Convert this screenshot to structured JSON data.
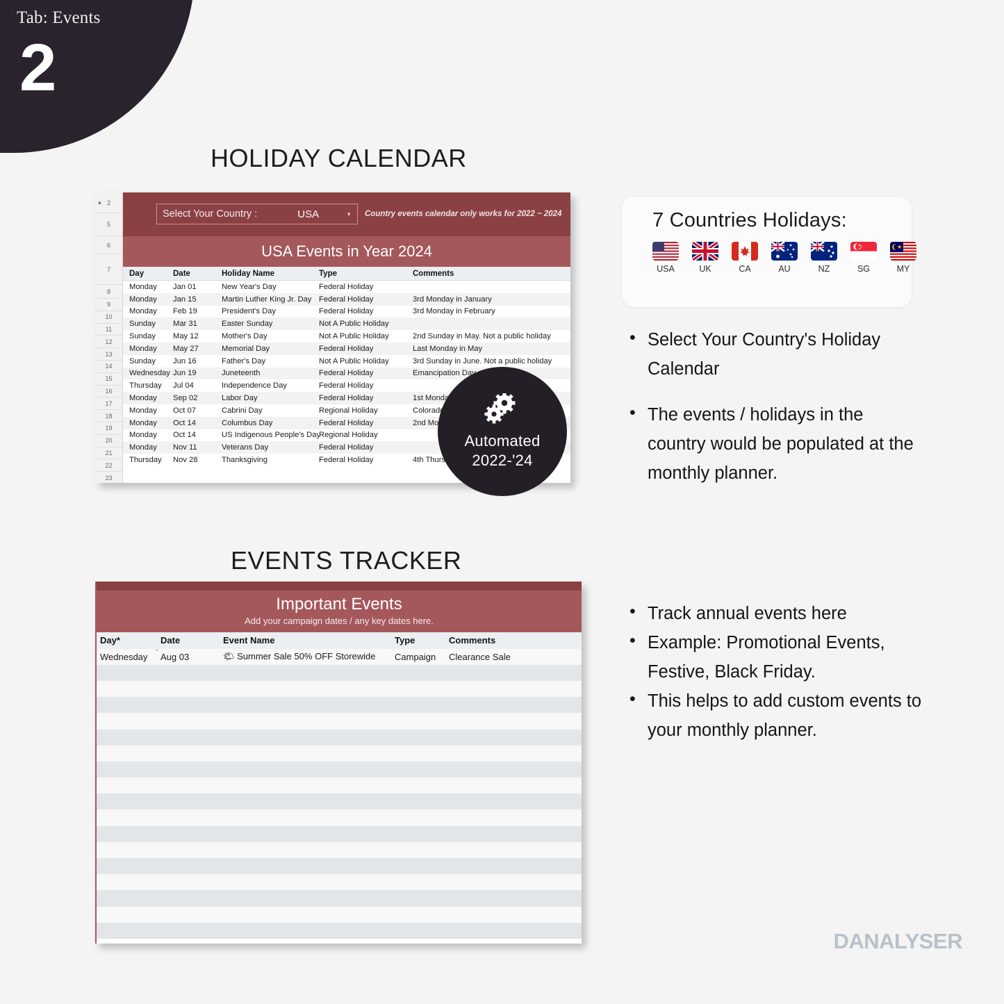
{
  "badge": {
    "tab_label": "Tab: Events",
    "number": "2",
    "bg_color": "#2a222c"
  },
  "sections": {
    "holiday_title": "HOLIDAY CALENDAR",
    "events_title": "EVENTS TRACKER"
  },
  "holiday_sheet": {
    "row_numbers": [
      "2",
      "5",
      "6",
      "7",
      "8",
      "9",
      "10",
      "11",
      "12",
      "13",
      "14",
      "15",
      "16",
      "17",
      "18",
      "19",
      "20",
      "21",
      "22",
      "23"
    ],
    "country_select": {
      "label": "Select Your Country :",
      "value": "USA",
      "caret": "chevron-down-icon"
    },
    "note": "Country events calendar only works for 2022 ~ 2024",
    "title_band": "USA Events in Year 2024",
    "columns": [
      "Day",
      "Date",
      "Holiday Name",
      "Type",
      "Comments"
    ],
    "rows": [
      [
        "Monday",
        "Jan 01",
        "New Year's Day",
        "Federal Holiday",
        ""
      ],
      [
        "Monday",
        "Jan 15",
        "Martin Luther King Jr. Day",
        "Federal Holiday",
        "3rd Monday in January"
      ],
      [
        "Monday",
        "Feb 19",
        "President's Day",
        "Federal Holiday",
        "3rd Monday in February"
      ],
      [
        "Sunday",
        "Mar 31",
        "Easter Sunday",
        "Not A Public Holiday",
        ""
      ],
      [
        "Sunday",
        "May 12",
        "Mother's Day",
        "Not A Public Holiday",
        "2nd Sunday in May. Not a public holiday"
      ],
      [
        "Monday",
        "May 27",
        "Memorial Day",
        "Federal Holiday",
        "Last Monday in May"
      ],
      [
        "Sunday",
        "Jun 16",
        "Father's Day",
        "Not A Public Holiday",
        "3rd Sunday in June. Not a public holiday"
      ],
      [
        "Wednesday",
        "Jun 19",
        "Juneteenth",
        "Federal Holiday",
        "Emancipation Day"
      ],
      [
        "Thursday",
        "Jul 04",
        "Independence Day",
        "Federal Holiday",
        ""
      ],
      [
        "Monday",
        "Sep 02",
        "Labor Day",
        "Federal Holiday",
        "1st Monday in September"
      ],
      [
        "Monday",
        "Oct 07",
        "Cabrini Day",
        "Regional Holiday",
        "Colorado"
      ],
      [
        "Monday",
        "Oct 14",
        "Columbus Day",
        "Federal Holiday",
        "2nd Monday in October"
      ],
      [
        "Monday",
        "Oct 14",
        "US Indigenous People's Day",
        "Regional Holiday",
        ""
      ],
      [
        "Monday",
        "Nov 11",
        "Veterans Day",
        "Federal Holiday",
        ""
      ],
      [
        "Thursday",
        "Nov 28",
        "Thanksgiving",
        "Federal Holiday",
        "4th Thursday in November"
      ]
    ],
    "colors": {
      "header_dark": "#8b4043",
      "header_light": "#a5585b"
    }
  },
  "automated_badge": {
    "icon": "gears-icon",
    "line1": "Automated",
    "line2": "2022-'24"
  },
  "countries_card": {
    "title": "7 Countries Holidays:",
    "flags": [
      {
        "code": "USA",
        "icon": "flag-usa-icon"
      },
      {
        "code": "UK",
        "icon": "flag-uk-icon"
      },
      {
        "code": "CA",
        "icon": "flag-canada-icon"
      },
      {
        "code": "AU",
        "icon": "flag-australia-icon"
      },
      {
        "code": "NZ",
        "icon": "flag-newzealand-icon"
      },
      {
        "code": "SG",
        "icon": "flag-singapore-icon"
      },
      {
        "code": "MY",
        "icon": "flag-malaysia-icon"
      }
    ]
  },
  "holiday_bullets": [
    "Select Your Country's Holiday Calendar",
    "The events / holidays in the country would be populated at the monthly planner."
  ],
  "events_sheet": {
    "title": "Important Events",
    "subtitle": "Add your campaign dates / any key dates here.",
    "columns": [
      "Day*",
      "Date",
      "Event Name",
      "Type",
      "Comments"
    ],
    "rows": [
      [
        "Wednesday",
        "Aug 03",
        "🌤 Summer Sale 50% OFF Storewide",
        "Campaign",
        "Clearance Sale"
      ]
    ],
    "empty_row_count": 17,
    "colors": {
      "header_dark": "#8b4043",
      "header_light": "#a5585b"
    }
  },
  "events_bullets": [
    "Track annual events here",
    "Example: Promotional Events, Festive, Black Friday.",
    "This helps to add custom events to your monthly planner."
  ],
  "watermark": "DANALYSER"
}
